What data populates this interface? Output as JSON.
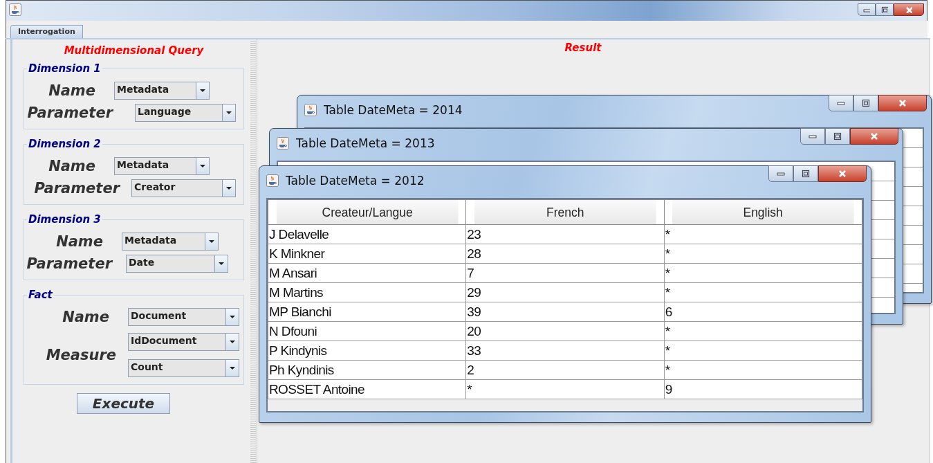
{
  "tabs": [
    {
      "label": "Interrogation",
      "selected": true
    }
  ],
  "query_panel": {
    "title": "Multidimensional Query",
    "groups": [
      {
        "title": "Dimension 1",
        "fields": [
          {
            "label": "Name",
            "values": [
              "Metadata"
            ]
          },
          {
            "label": "Parameter",
            "values": [
              "Language"
            ]
          }
        ]
      },
      {
        "title": "Dimension 2",
        "fields": [
          {
            "label": "Name",
            "values": [
              "Metadata"
            ]
          },
          {
            "label": "Parameter",
            "values": [
              "Creator"
            ]
          }
        ]
      },
      {
        "title": "Dimension 3",
        "fields": [
          {
            "label": "Name",
            "values": [
              "Metadata"
            ]
          },
          {
            "label": "Parameter",
            "values": [
              "Date"
            ]
          }
        ]
      },
      {
        "title": "Fact",
        "fields": [
          {
            "label": "Name",
            "values": [
              "Document"
            ]
          },
          {
            "label": "Measure",
            "values": [
              "IdDocument",
              "Count"
            ]
          }
        ]
      }
    ],
    "execute_button": "Execute"
  },
  "result_panel": {
    "title": "Result",
    "windows": [
      {
        "title": "Table DateMeta = 2014"
      },
      {
        "title": "Table DateMeta = 2013"
      },
      {
        "title": "Table DateMeta = 2012",
        "table": {
          "columns": [
            "Createur/Langue",
            "French",
            "English"
          ],
          "rows": [
            [
              "J Delavelle",
              "23",
              "*"
            ],
            [
              "K Minkner",
              "28",
              "*"
            ],
            [
              "M Ansari",
              "7",
              "*"
            ],
            [
              "M Martins",
              "29",
              "*"
            ],
            [
              "MP Bianchi",
              "39",
              "6"
            ],
            [
              "N Dfouni",
              "20",
              "*"
            ],
            [
              "P Kindynis",
              "33",
              "*"
            ],
            [
              "Ph Kyndinis",
              "2",
              "*"
            ],
            [
              "ROSSET Antoine",
              "*",
              "9"
            ]
          ]
        }
      }
    ]
  }
}
